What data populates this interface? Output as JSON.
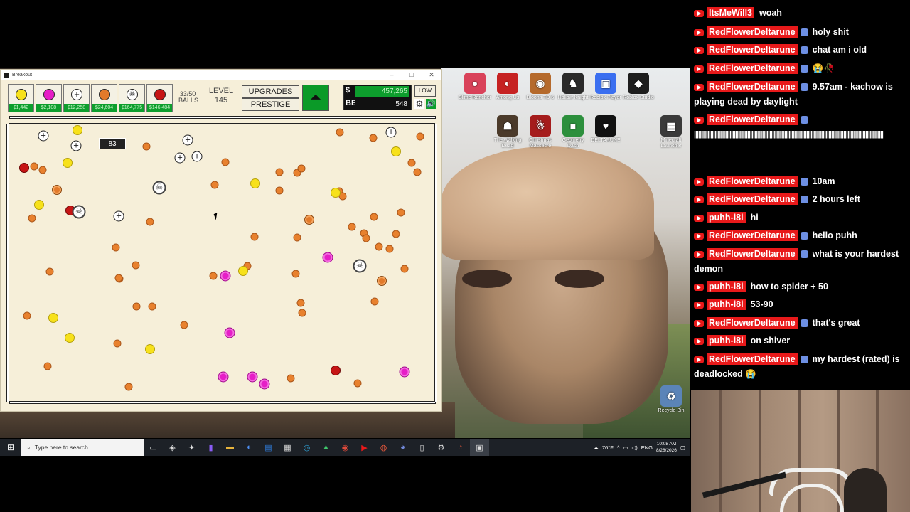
{
  "window": {
    "title": "Breakout"
  },
  "toolbar": {
    "shop": [
      {
        "name": "basic-yellow",
        "color": "#f7e11b",
        "price": "$1,442"
      },
      {
        "name": "pink",
        "color": "#e61ec7",
        "price": "$2,108"
      },
      {
        "name": "plus",
        "color": "#ffffff",
        "price": "$12,258"
      },
      {
        "name": "orange",
        "color": "#e27a2b",
        "price": "$24,604"
      },
      {
        "name": "skull",
        "color": "#ffffff",
        "price": "$164,775"
      },
      {
        "name": "red",
        "color": "#c61515",
        "price": "$146,484"
      }
    ],
    "balls_count": "33/50",
    "balls_label": "BALLS",
    "level_label": "LEVEL",
    "level_value": "145",
    "upgrades_label": "UPGRADES",
    "prestige_label": "PRESTIGE",
    "money_symbol": "$",
    "money_value": "457,265",
    "bb_label": "BB",
    "bb_value": "548",
    "quality_label": "LOW"
  },
  "arena": {
    "floating_number": "83"
  },
  "desktop": {
    "icons": [
      {
        "label": "Slime Rancher",
        "color": "#d9425a",
        "glyph": "●"
      },
      {
        "label": "Among Us",
        "color": "#c62222",
        "glyph": "◐"
      },
      {
        "label": "Bloons TD 6",
        "color": "#b56a2c",
        "glyph": "◉"
      },
      {
        "label": "Hollow Knight",
        "color": "#2a2a2a",
        "glyph": "♞"
      },
      {
        "label": "Roblox Player",
        "color": "#3b6ff0",
        "glyph": "▣"
      },
      {
        "label": "Roblox Studio",
        "color": "#1d1d1d",
        "glyph": "◆"
      },
      {
        "label": "The Walking Dead",
        "color": "#4b3a2a",
        "glyph": "☗"
      },
      {
        "label": "Christmas Massacre",
        "color": "#a51c1c",
        "glyph": "☃"
      },
      {
        "label": "Geometry Dash",
        "color": "#2c8f3c",
        "glyph": "■"
      },
      {
        "label": "DELTARUNE",
        "color": "#111111",
        "glyph": "♥"
      },
      {
        "label": "Minecraft Launcher",
        "color": "#3a3a3a",
        "glyph": "▦"
      },
      {
        "label": "Recycle Bin",
        "color": "#5b84b8",
        "glyph": "♻"
      }
    ]
  },
  "taskbar": {
    "search_placeholder": "Type here to search",
    "weather": "76°F",
    "lang": "ENG",
    "time": "10:08 AM",
    "date": "8/28/2026"
  },
  "chat": {
    "messages": [
      {
        "user": "ItsMeWill3",
        "badge": false,
        "text": "woah"
      },
      {
        "user": "RedFlowerDeltarune",
        "badge": true,
        "text": "holy shit"
      },
      {
        "user": "RedFlowerDeltarune",
        "badge": true,
        "text": "chat am i old"
      },
      {
        "user": "RedFlowerDeltarune",
        "badge": true,
        "text": "😭🥀"
      },
      {
        "user": "RedFlowerDeltarune",
        "badge": true,
        "text": "9.57am - kachow is playing dead by daylight"
      },
      {
        "user": "RedFlowerDeltarune",
        "badge": true,
        "text": "||||||||||||||||||||||||||||||||||||||||||||||||||||||||||||||||||||||||||||||||||||||||||||||||||||||||||||||||||||||||||||||||"
      },
      {
        "user": "RedFlowerDeltarune",
        "badge": true,
        "text": "10am"
      },
      {
        "user": "RedFlowerDeltarune",
        "badge": true,
        "text": "2 hours left"
      },
      {
        "user": "puhh-i8i",
        "badge": false,
        "text": "hi"
      },
      {
        "user": "RedFlowerDeltarune",
        "badge": true,
        "text": "hello puhh"
      },
      {
        "user": "RedFlowerDeltarune",
        "badge": true,
        "text": "what is your hardest demon"
      },
      {
        "user": "puhh-i8i",
        "badge": false,
        "text": "how to spider + 50"
      },
      {
        "user": "puhh-i8i",
        "badge": false,
        "text": "53-90"
      },
      {
        "user": "RedFlowerDeltarune",
        "badge": true,
        "text": "that's great"
      },
      {
        "user": "puhh-i8i",
        "badge": false,
        "text": "on shiver"
      },
      {
        "user": "RedFlowerDeltarune",
        "badge": true,
        "text": "my hardest (rated) is deadlocked 😭"
      }
    ]
  }
}
